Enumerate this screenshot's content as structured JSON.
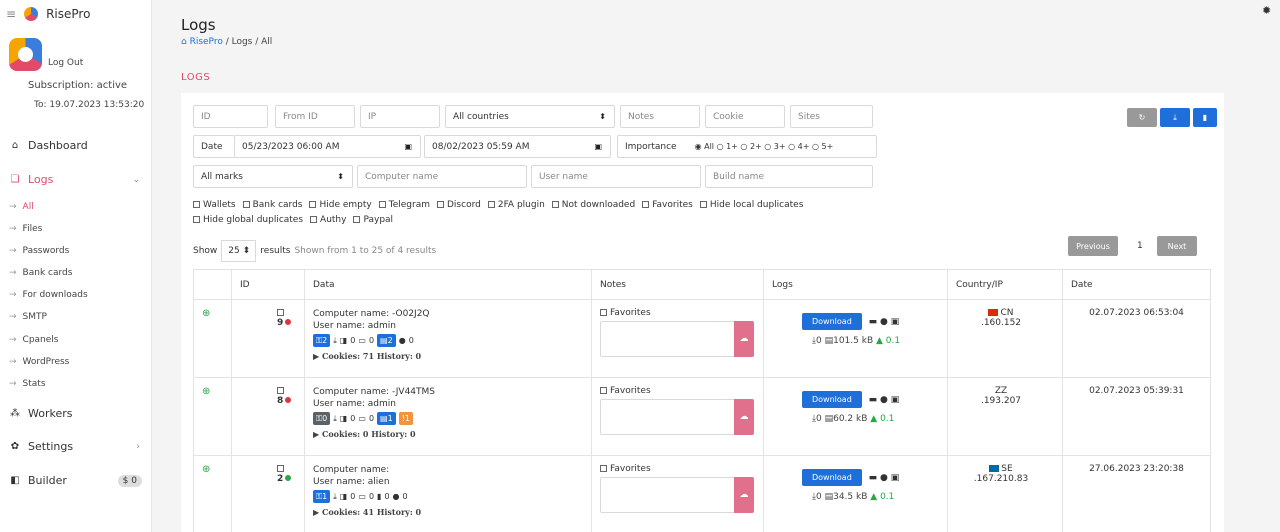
{
  "brand": "RisePro",
  "account": {
    "logout": "Log Out",
    "subscription": "Subscription: active",
    "to": "To: 19.07.2023 13:53:20"
  },
  "nav": [
    {
      "label": "Dashboard",
      "icon": "home-icon"
    },
    {
      "label": "Logs",
      "icon": "book-icon"
    },
    {
      "label": "Workers",
      "icon": "users-icon"
    },
    {
      "label": "Settings",
      "icon": "gear-icon"
    },
    {
      "label": "Builder",
      "icon": "box-icon",
      "badge": "$ 0"
    }
  ],
  "subnav": [
    "All",
    "Files",
    "Passwords",
    "Bank cards",
    "For downloads",
    "SMTP",
    "Cpanels",
    "WordPress",
    "Stats"
  ],
  "page": {
    "title": "Logs",
    "breadcrumb": {
      "home": "RisePro",
      "rest": " / Logs / All"
    },
    "section": "LOGS"
  },
  "filters": {
    "id": "ID",
    "from_id": "From ID",
    "ip": "IP",
    "countries": "All countries",
    "notes": "Notes",
    "cookie": "Cookie",
    "sites": "Sites",
    "date_label": "Date",
    "date_from": "05/23/2023 06:00 AM",
    "date_to": "08/02/2023 05:59 AM",
    "importance_label": "Importance",
    "importance_opts": "◉ All ○ 1+ ○ 2+ ○ 3+ ○ 4+ ○ 5+",
    "marks": "All marks",
    "computer_name": "Computer name",
    "user_name": "User name",
    "build_name": "Build name",
    "checks1": [
      "Wallets",
      "Bank cards",
      "Hide empty",
      "Telegram",
      "Discord",
      "2FA plugin",
      "Not downloaded",
      "Favorites",
      "Hide local duplicates"
    ],
    "checks2": [
      "Hide global duplicates",
      "Authy",
      "Paypal"
    ]
  },
  "paging": {
    "show": "Show",
    "per_page": "25",
    "results": "results",
    "info": "Shown from 1 to 25 of 4 results",
    "prev": "Previous",
    "page": "1",
    "next": "Next"
  },
  "table": {
    "headers": [
      "ID",
      "Data",
      "Notes",
      "Logs",
      "Country/IP",
      "Date"
    ],
    "rows": [
      {
        "id": "9",
        "dot_color": "#dc3545",
        "computer": "Computer name:             -O02J2Q",
        "user": "User name: admin",
        "keys": "2",
        "files": "0",
        "cards": "0",
        "docs": "2",
        "other": "0",
        "cookies": "Cookies: 71  History: 0",
        "fav": "Favorites",
        "download": "Download",
        "size_line": "0",
        "size": "101.5 kB",
        "score": "0.1",
        "country": "CN",
        "ip": ".160.152",
        "date": "02.07.2023 06:53:04",
        "flag_color": "#de2910"
      },
      {
        "id": "8",
        "dot_color": "#dc3545",
        "computer": "Computer name:                  -JV44TMS",
        "user": "User name: admin",
        "keys": "0",
        "files": "0",
        "cards": "0",
        "docs": "1",
        "other": "1",
        "cookies": "Cookies: 0  History: 0",
        "fav": "Favorites",
        "download": "Download",
        "size_line": "0",
        "size": "60.2 kB",
        "score": "0.1",
        "country": "ZZ",
        "ip": ".193.207",
        "date": "02.07.2023 05:39:31",
        "flag_color": ""
      },
      {
        "id": "2",
        "dot_color": "#28a745",
        "computer": "Computer name:",
        "user": "User name: alien",
        "keys": "1",
        "files": "0",
        "cards": "0",
        "docs": "0",
        "other": "0",
        "cookies": "Cookies: 41  History: 0",
        "fav": "Favorites",
        "download": "Download",
        "size_line": "0",
        "size": "34.5 kB",
        "score": "0.1",
        "country": "SE",
        "ip": ".167.210.83",
        "date": "27.06.2023 23:20:38",
        "flag_color": "#006aa7"
      }
    ]
  }
}
